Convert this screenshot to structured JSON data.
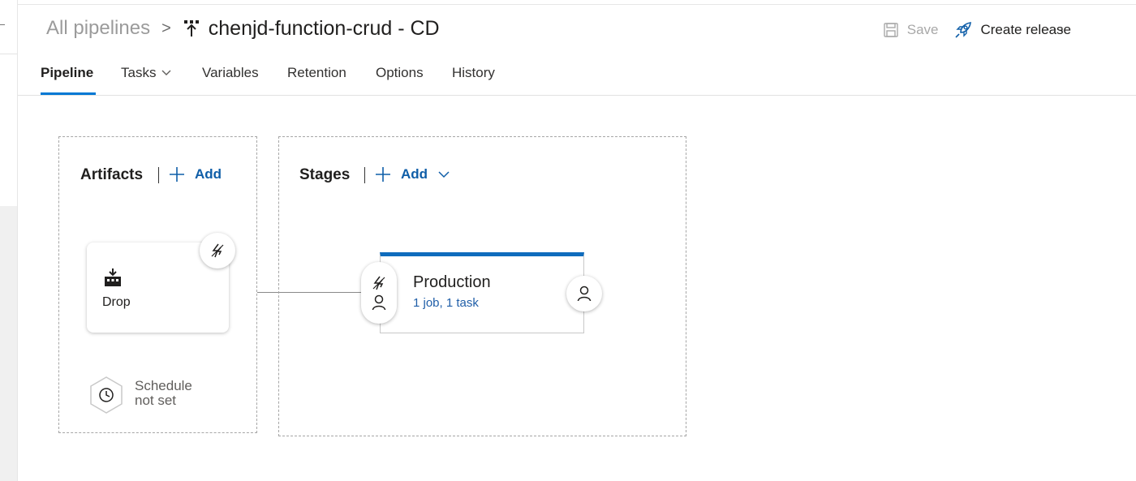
{
  "breadcrumb": {
    "root_label": "All pipelines",
    "separator": ">",
    "title": "chenjd-function-crud - CD"
  },
  "toolbar": {
    "save_label": "Save",
    "create_release_label": "Create release",
    "more_label": "···"
  },
  "tabs": [
    {
      "label": "Pipeline",
      "active": true
    },
    {
      "label": "Tasks",
      "has_dropdown": true
    },
    {
      "label": "Variables"
    },
    {
      "label": "Retention"
    },
    {
      "label": "Options"
    },
    {
      "label": "History"
    }
  ],
  "artifacts": {
    "title": "Artifacts",
    "add_label": "Add",
    "items": [
      {
        "name": "Drop",
        "icon": "build-artifact-icon"
      }
    ],
    "schedule": {
      "line1": "Schedule",
      "line2": "not set"
    }
  },
  "stages": {
    "title": "Stages",
    "add_label": "Add",
    "items": [
      {
        "name": "Production",
        "summary": "1 job, 1 task"
      }
    ]
  },
  "colors": {
    "accent": "#0078d4",
    "link": "#0f5ea8",
    "stage_top_bar": "#0f6cbd",
    "disabled": "#a8a8a8"
  }
}
